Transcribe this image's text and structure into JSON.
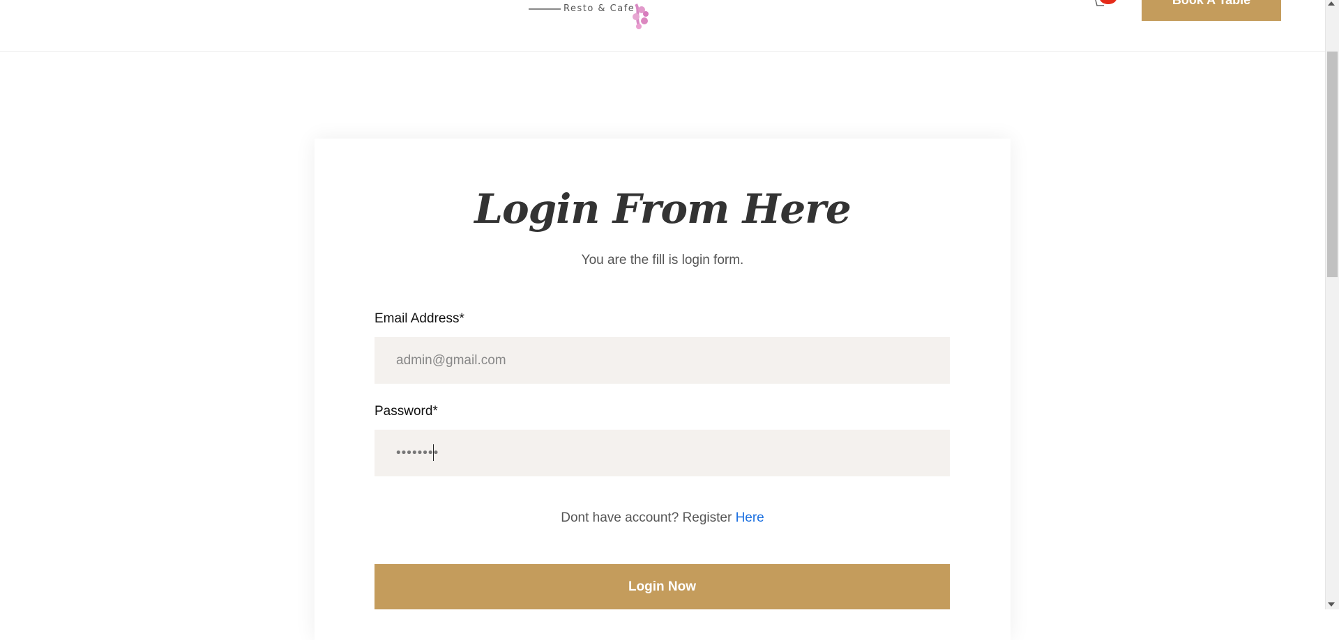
{
  "header": {
    "logo_text": "Resto & Cafe",
    "cart_icon": "cart-icon",
    "book_button_label": "Book A Table"
  },
  "login": {
    "title": "Login From Here",
    "subtitle": "You are the fill is login form.",
    "email_label": "Email Address*",
    "email_value": "admin@gmail.com",
    "password_label": "Password*",
    "password_value": "••••••••",
    "register_text": "Dont have account? Register ",
    "register_link": "Here",
    "submit_label": "Login Now"
  },
  "colors": {
    "accent": "#c49c5c",
    "input_bg": "#f4f1ee",
    "link": "#1a6fe0",
    "badge": "#e52b1a"
  }
}
